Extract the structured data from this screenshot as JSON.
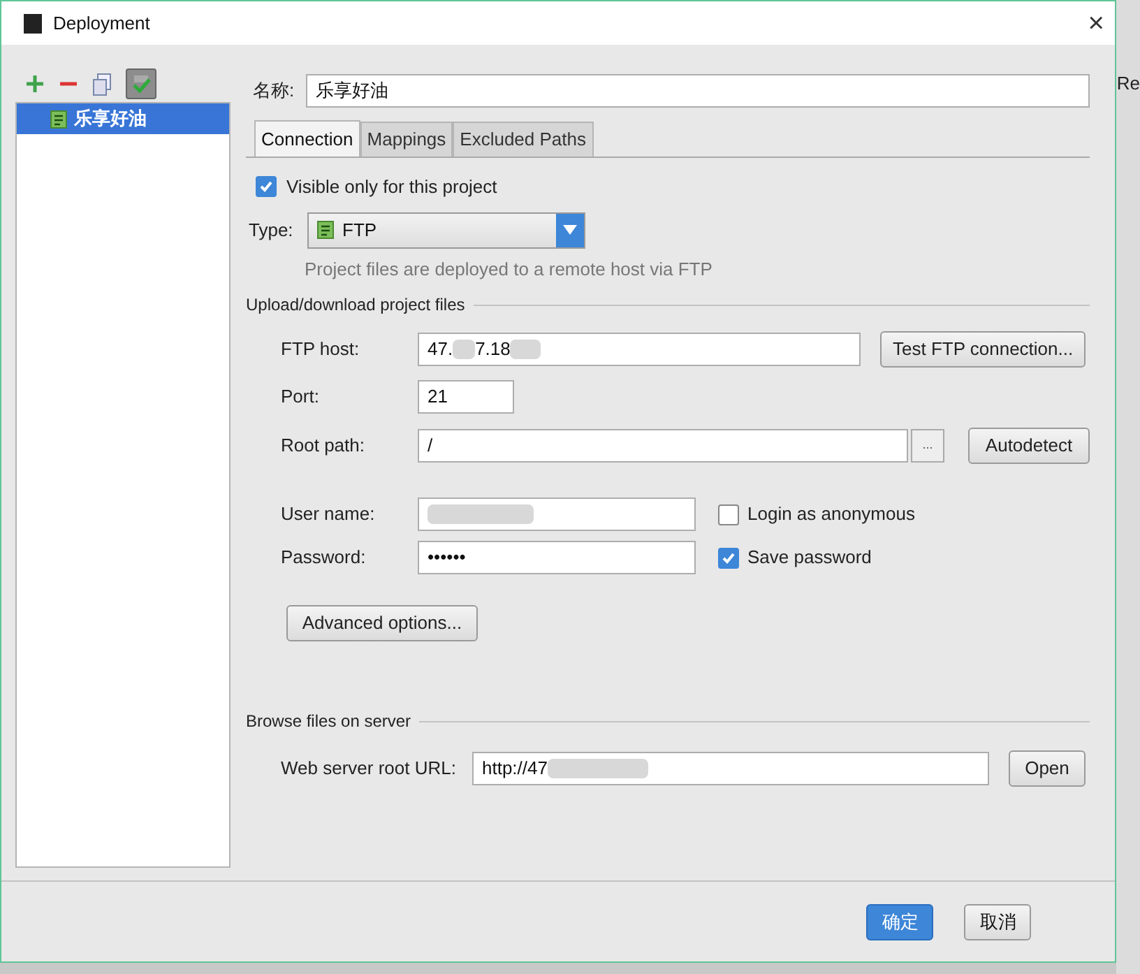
{
  "window": {
    "title": "Deployment",
    "close": "×"
  },
  "toolbar": [
    {
      "kind": "add"
    },
    {
      "kind": "remove"
    },
    {
      "kind": "copy"
    },
    {
      "kind": "default",
      "selected": true
    }
  ],
  "servers": [
    {
      "name": "乐享好油",
      "selected": true
    }
  ],
  "name_field": {
    "label": "名称:",
    "value": "乐享好油"
  },
  "tabs": [
    {
      "label": "Connection",
      "selected": true
    },
    {
      "label": "Mappings",
      "selected": false
    },
    {
      "label": "Excluded Paths",
      "selected": false
    }
  ],
  "visible_only": {
    "label": "Visible only for this project",
    "checked": true
  },
  "type": {
    "label": "Type:",
    "value": "FTP",
    "hint": "Project files are deployed to a remote host via FTP"
  },
  "upload_section": {
    "title": "Upload/download project files"
  },
  "ftp_host": {
    "label": "FTP host:",
    "value_start": "47.",
    "value_end": "7.18",
    "button": "Test FTP connection..."
  },
  "port": {
    "label": "Port:",
    "value": "21"
  },
  "root_path": {
    "label": "Root path:",
    "value": "/",
    "browse": "...",
    "button": "Autodetect"
  },
  "user_name": {
    "label": "User name:",
    "anonymous": {
      "label": "Login as anonymous",
      "checked": false
    }
  },
  "password": {
    "label": "Password:",
    "value": "••••••",
    "save": {
      "label": "Save password",
      "checked": true
    }
  },
  "advanced_button": {
    "label": "Advanced options..."
  },
  "browse_section": {
    "title": "Browse files on server"
  },
  "web_url": {
    "label": "Web server root URL:",
    "value_start": "http://47",
    "button": "Open"
  },
  "buttons": [
    {
      "label": "确定",
      "primary": true
    },
    {
      "label": "取消",
      "primary": false
    }
  ],
  "background_window": {
    "text": "Re"
  }
}
